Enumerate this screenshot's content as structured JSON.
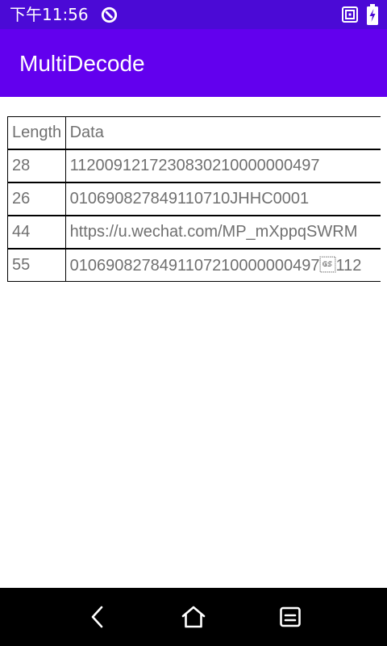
{
  "status_bar": {
    "time": "下午11:56",
    "icons": [
      "data-saver-icon",
      "nfc-icon",
      "battery-charging-icon"
    ]
  },
  "app_bar": {
    "title": "MultiDecode"
  },
  "table": {
    "headers": {
      "length": "Length",
      "data": "Data"
    },
    "rows": [
      {
        "length": "28",
        "data": "1120091217230830210000000497"
      },
      {
        "length": "26",
        "data": "010690827849110710JHHC0001"
      },
      {
        "length": "44",
        "data": "https://u.wechat.com/MP_mXppqSWRM"
      },
      {
        "length": "55",
        "data": "010690827849110721000000049​7\u001d112"
      }
    ]
  },
  "nav_bar": {
    "buttons": [
      "back-icon",
      "home-icon",
      "recents-icon"
    ]
  },
  "colors": {
    "status_bar": "#4b0ad6",
    "app_bar": "#6200ee",
    "table_text": "#707070",
    "nav_bar": "#000000"
  }
}
